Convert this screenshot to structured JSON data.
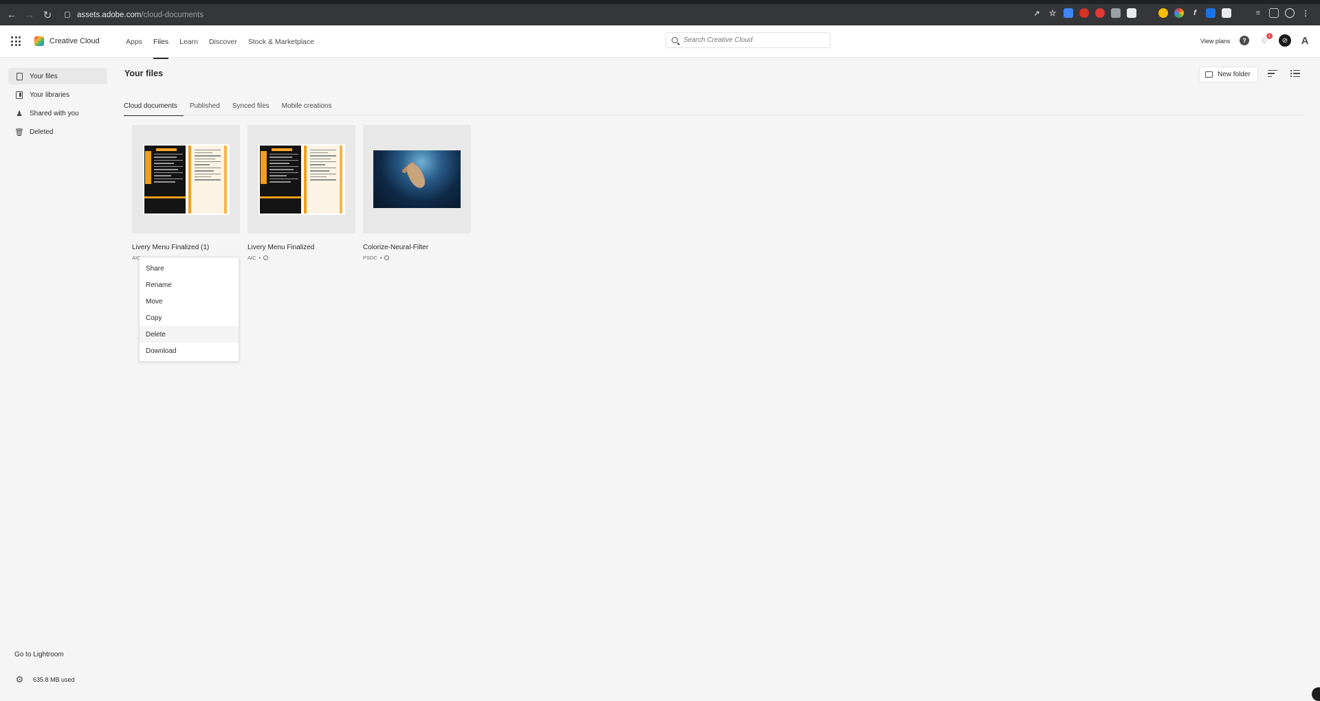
{
  "browser": {
    "url_host": "assets.adobe.com",
    "url_path": "/cloud-documents"
  },
  "header": {
    "brand": "Creative Cloud",
    "nav": [
      "Apps",
      "Files",
      "Learn",
      "Discover",
      "Stock & Marketplace"
    ],
    "active_nav": "Files",
    "search_placeholder": "Search Creative Cloud",
    "view_plans": "View plans",
    "notification_count": "1"
  },
  "sidebar": {
    "items": [
      {
        "label": "Your files",
        "icon": "file-icon"
      },
      {
        "label": "Your libraries",
        "icon": "library-icon"
      },
      {
        "label": "Shared with you",
        "icon": "shared-user-icon"
      },
      {
        "label": "Deleted",
        "icon": "trash-icon"
      }
    ],
    "go_lightroom": "Go to Lightroom",
    "storage": "635.8 MB used"
  },
  "main": {
    "title": "Your files",
    "new_folder": "New folder",
    "tabs": [
      "Cloud documents",
      "Published",
      "Synced files",
      "Mobile creations"
    ],
    "files": [
      {
        "name": "Livery Menu Finalized (1)",
        "type": "AIC"
      },
      {
        "name": "Livery Menu Finalized",
        "type": "AIC"
      },
      {
        "name": "Colorize-Neural-Filter",
        "type": "PSDC"
      }
    ]
  },
  "context_menu": {
    "items": [
      "Share",
      "Rename",
      "Move",
      "Copy",
      "Delete",
      "Download"
    ],
    "hovered": "Delete"
  },
  "colors": {
    "accent": "#2c2c2c",
    "notification": "#e34850",
    "menu_orange": "#f29d1c"
  }
}
